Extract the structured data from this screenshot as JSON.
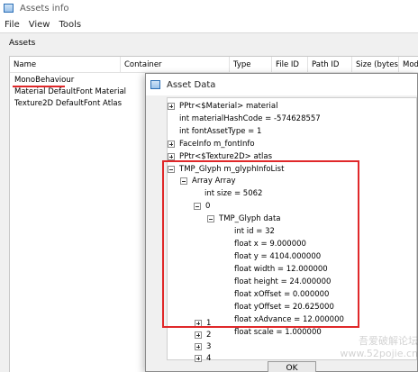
{
  "window": {
    "title": "Assets info"
  },
  "menu": [
    "File",
    "View",
    "Tools"
  ],
  "assets": {
    "label": "Assets",
    "columns": [
      "Name",
      "Container",
      "Type",
      "File ID",
      "Path ID",
      "Size (bytes)",
      "Modi"
    ],
    "rows": [
      "MonoBehaviour",
      "Material DefaultFont Material",
      "Texture2D DefaultFont Atlas"
    ]
  },
  "dialog": {
    "title": "Asset Data",
    "ok_label": "OK",
    "tree": [
      "PPtr<$Material> material",
      "int materialHashCode = -574628557",
      "int fontAssetType = 1",
      "FaceInfo m_fontInfo",
      "PPtr<$Texture2D> atlas",
      "TMP_Glyph m_glyphInfoList",
      "Array Array",
      "int size = 5062",
      "0",
      "TMP_Glyph data",
      "int id = 32",
      "float x = 9.000000",
      "float y = 4104.000000",
      "float width = 12.000000",
      "float height = 24.000000",
      "float xOffset = 0.000000",
      "float yOffset = 20.625000",
      "float xAdvance = 12.000000",
      "float scale = 1.000000",
      "1",
      "2",
      "3",
      "4"
    ]
  },
  "watermark": {
    "line1": "吾爱破解论坛",
    "line2": "www.52pojie.cn"
  },
  "colors": {
    "highlight": "#e0282a"
  }
}
